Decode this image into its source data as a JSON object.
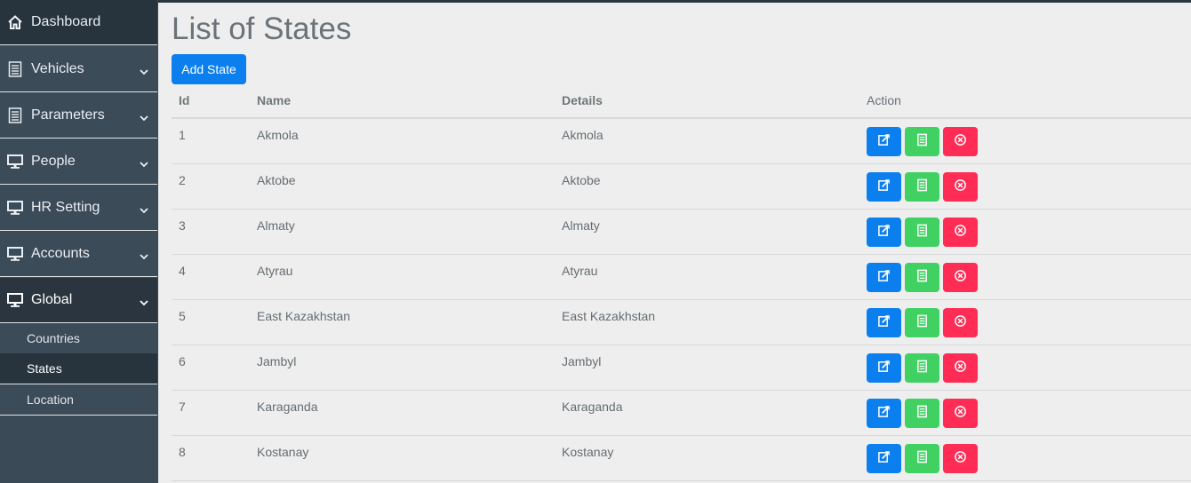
{
  "sidebar": {
    "items": [
      {
        "label": "Dashboard",
        "icon": "home-icon"
      },
      {
        "label": "Vehicles",
        "icon": "document-icon"
      },
      {
        "label": "Parameters",
        "icon": "document-icon"
      },
      {
        "label": "People",
        "icon": "monitor-icon"
      },
      {
        "label": "HR Setting",
        "icon": "monitor-icon"
      },
      {
        "label": "Accounts",
        "icon": "monitor-icon"
      },
      {
        "label": "Global",
        "icon": "monitor-icon"
      }
    ],
    "sub_items": [
      {
        "label": "Countries"
      },
      {
        "label": "States"
      },
      {
        "label": "Location"
      }
    ]
  },
  "page": {
    "title": "List of States",
    "add_button": "Add State"
  },
  "table": {
    "headers": {
      "id": "Id",
      "name": "Name",
      "details": "Details",
      "action": "Action"
    },
    "rows": [
      {
        "id": "1",
        "name": "Akmola",
        "details": "Akmola"
      },
      {
        "id": "2",
        "name": "Aktobe",
        "details": "Aktobe"
      },
      {
        "id": "3",
        "name": "Almaty",
        "details": "Almaty"
      },
      {
        "id": "4",
        "name": "Atyrau",
        "details": "Atyrau"
      },
      {
        "id": "5",
        "name": "East Kazakhstan",
        "details": "East Kazakhstan"
      },
      {
        "id": "6",
        "name": "Jambyl",
        "details": "Jambyl"
      },
      {
        "id": "7",
        "name": "Karaganda",
        "details": "Karaganda"
      },
      {
        "id": "8",
        "name": "Kostanay",
        "details": "Kostanay"
      }
    ]
  },
  "colors": {
    "sidebar": "#3c4b58",
    "sidebar_active": "#27333d",
    "primary": "#0c7fee",
    "success": "#41d163",
    "danger": "#ff2d55"
  }
}
